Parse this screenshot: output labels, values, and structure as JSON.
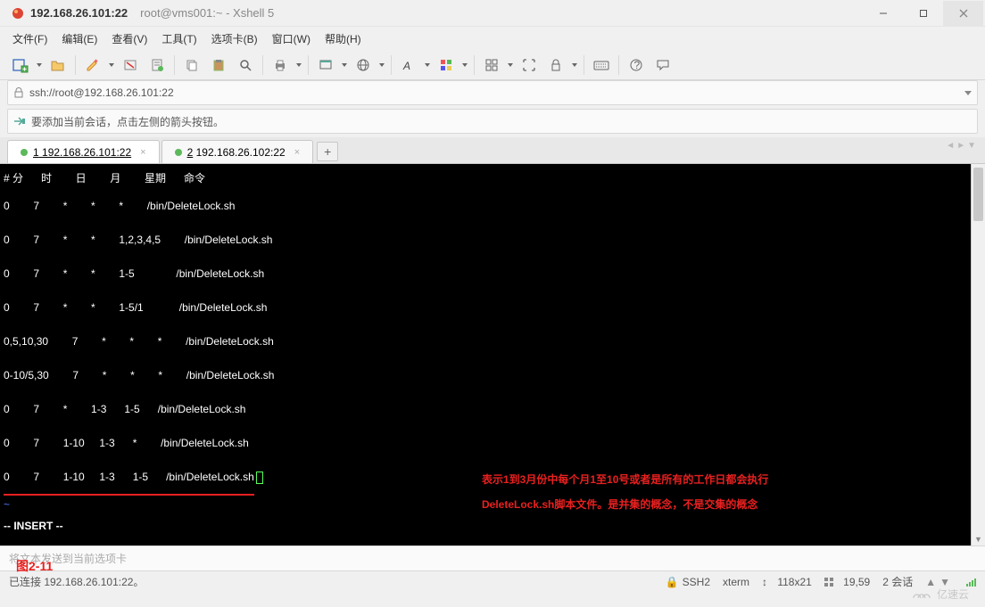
{
  "title": {
    "session": "192.168.26.101:22",
    "app": "root@vms001:~ - Xshell 5"
  },
  "menu": {
    "file": "文件(F)",
    "edit": "编辑(E)",
    "view": "查看(V)",
    "tools": "工具(T)",
    "tabs": "选项卡(B)",
    "window": "窗口(W)",
    "help": "帮助(H)"
  },
  "toolbar_icons": {
    "new_session": "new-session-icon",
    "open": "open-icon",
    "pencil": "pencil-icon",
    "disconnect": "disconnect-icon",
    "properties": "properties-icon",
    "copy": "copy-icon",
    "paste": "paste-icon",
    "find": "find-icon",
    "print": "print-icon",
    "fullscreen": "fullscreen-icon",
    "globe": "globe-icon",
    "font": "font-icon",
    "color": "color-icon",
    "sessions": "sessions-icon",
    "fit": "fit-icon",
    "lock": "lock-icon",
    "keyboard": "keyboard-icon",
    "help": "help-icon",
    "chat": "chat-icon"
  },
  "address": "ssh://root@192.168.26.101:22",
  "info_hint": "要添加当前会话，点击左侧的箭头按钮。",
  "tabs": {
    "active": {
      "index": "1",
      "label": "192.168.26.101:22"
    },
    "inactive": {
      "index": "2",
      "label": "192.168.26.102:22"
    },
    "add": "+"
  },
  "cron": {
    "headers": {
      "prefix": "#",
      "min": "分",
      "hour": "时",
      "day": "日",
      "month": "月",
      "week": "星期",
      "cmd": "命令"
    },
    "rows": [
      {
        "c1": "0",
        "c2": "7",
        "c3": "*",
        "c4": "*",
        "c5": "*",
        "cmd": "/bin/DeleteLock.sh"
      },
      {
        "c1": "0",
        "c2": "7",
        "c3": "*",
        "c4": "*",
        "c5": "1,2,3,4,5",
        "cmd": "/bin/DeleteLock.sh"
      },
      {
        "c1": "0",
        "c2": "7",
        "c3": "*",
        "c4": "*",
        "c5": "1-5",
        "cmd": "/bin/DeleteLock.sh"
      },
      {
        "c1": "0",
        "c2": "7",
        "c3": "*",
        "c4": "*",
        "c5": "1-5/1",
        "cmd": "/bin/DeleteLock.sh"
      },
      {
        "c1": "0,5,10,30",
        "c2": "7",
        "c3": "*",
        "c4": "*",
        "c5": "*",
        "cmd": "/bin/DeleteLock.sh"
      },
      {
        "c1": "0-10/5,30",
        "c2": "7",
        "c3": "*",
        "c4": "*",
        "c5": "*",
        "cmd": "/bin/DeleteLock.sh"
      },
      {
        "c1": "0",
        "c2": "7",
        "c3": "*",
        "c4": "1-3",
        "c5": "1-5",
        "cmd": "/bin/DeleteLock.sh"
      },
      {
        "c1": "0",
        "c2": "7",
        "c3": "1-10",
        "c4": "1-3",
        "c5": "*",
        "cmd": "/bin/DeleteLock.sh"
      },
      {
        "c1": "0",
        "c2": "7",
        "c3": "1-10",
        "c4": "1-3",
        "c5": "1-5",
        "cmd": "/bin/DeleteLock.sh"
      }
    ],
    "tilde": "~",
    "mode": "-- INSERT --"
  },
  "annotation": {
    "line1": "表示1到3月份中每个月1至10号或者是所有的工作日都会执行",
    "line2": "DeleteLock.sh脚本文件。是并集的概念，不是交集的概念"
  },
  "figure_label": "图2-11",
  "prompt_hint": "将文本发送到当前选项卡",
  "status": {
    "connected": "已连接 192.168.26.101:22。",
    "ssh": "SSH2",
    "term": "xterm",
    "size": "118x21",
    "pos": "19,59",
    "sessions": "2 会话",
    "lock": "🔒",
    "arrows": "⇅",
    "upd": "↕"
  },
  "watermark": "亿速云"
}
